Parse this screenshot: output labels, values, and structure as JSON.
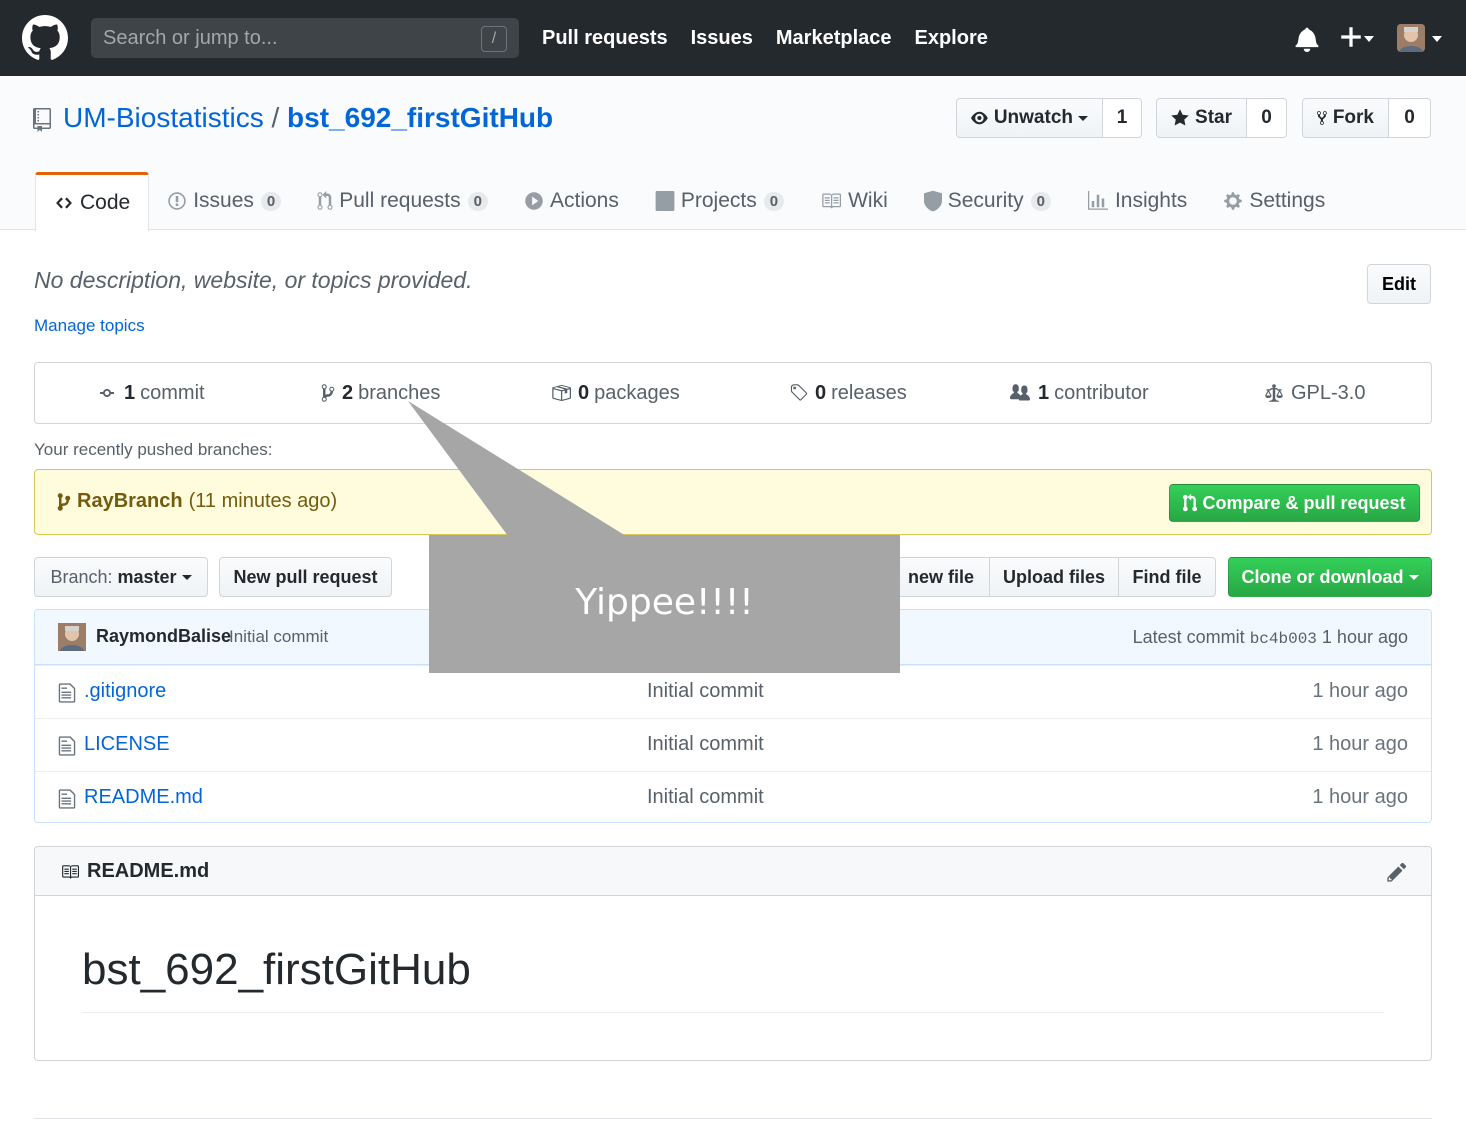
{
  "header": {
    "search_placeholder": "Search or jump to...",
    "search_shortcut": "/",
    "nav": [
      "Pull requests",
      "Issues",
      "Marketplace",
      "Explore"
    ]
  },
  "repo": {
    "owner": "UM-Biostatistics",
    "separator": "/",
    "name": "bst_692_firstGitHub",
    "watch_label": "Unwatch",
    "watch_count": "1",
    "star_label": "Star",
    "star_count": "0",
    "fork_label": "Fork",
    "fork_count": "0"
  },
  "tabs": [
    {
      "label": "Code",
      "icon": "code-icon"
    },
    {
      "label": "Issues",
      "count": "0",
      "icon": "issue-icon"
    },
    {
      "label": "Pull requests",
      "count": "0",
      "icon": "pull-request-icon"
    },
    {
      "label": "Actions",
      "icon": "play-icon"
    },
    {
      "label": "Projects",
      "count": "0",
      "icon": "project-icon"
    },
    {
      "label": "Wiki",
      "icon": "book-icon"
    },
    {
      "label": "Security",
      "count": "0",
      "icon": "shield-icon"
    },
    {
      "label": "Insights",
      "icon": "graph-icon"
    },
    {
      "label": "Settings",
      "icon": "gear-icon"
    }
  ],
  "about": {
    "description": "No description, website, or topics provided.",
    "edit_label": "Edit",
    "manage_topics": "Manage topics"
  },
  "summary": {
    "commits_num": "1",
    "commits_label": "commit",
    "branches_num": "2",
    "branches_label": "branches",
    "packages_num": "0",
    "packages_label": "packages",
    "releases_num": "0",
    "releases_label": "releases",
    "contributors_num": "1",
    "contributors_label": "contributor",
    "license": "GPL-3.0"
  },
  "recent": {
    "label": "Your recently pushed branches:",
    "branch": "RayBranch",
    "time": "(11 minutes ago)",
    "compare_label": "Compare & pull request"
  },
  "filenav": {
    "branch_prefix": "Branch:",
    "branch_name": "master",
    "new_pr_label": "New pull request",
    "create_file_partial": "new file",
    "upload_label": "Upload files",
    "find_label": "Find file",
    "clone_label": "Clone or download"
  },
  "commit": {
    "author": "RaymondBalise",
    "message": "Initial commit",
    "latest_label": "Latest commit",
    "sha": "bc4b003",
    "age": "1 hour ago"
  },
  "files": [
    {
      "name": ".gitignore",
      "message": "Initial commit",
      "age": "1 hour ago"
    },
    {
      "name": "LICENSE",
      "message": "Initial commit",
      "age": "1 hour ago"
    },
    {
      "name": "README.md",
      "message": "Initial commit",
      "age": "1 hour ago"
    }
  ],
  "readme": {
    "title": "README.md",
    "heading": "bst_692_firstGitHub"
  },
  "callout": {
    "text": "Yippee!!!!"
  },
  "colors": {
    "header_bg": "#24292e",
    "link": "#0366d6",
    "primary_green": "#28a745",
    "selected_tab_accent": "#e36209",
    "recent_banner_bg": "#fffbdd",
    "callout_gray": "#a6a6a6"
  }
}
